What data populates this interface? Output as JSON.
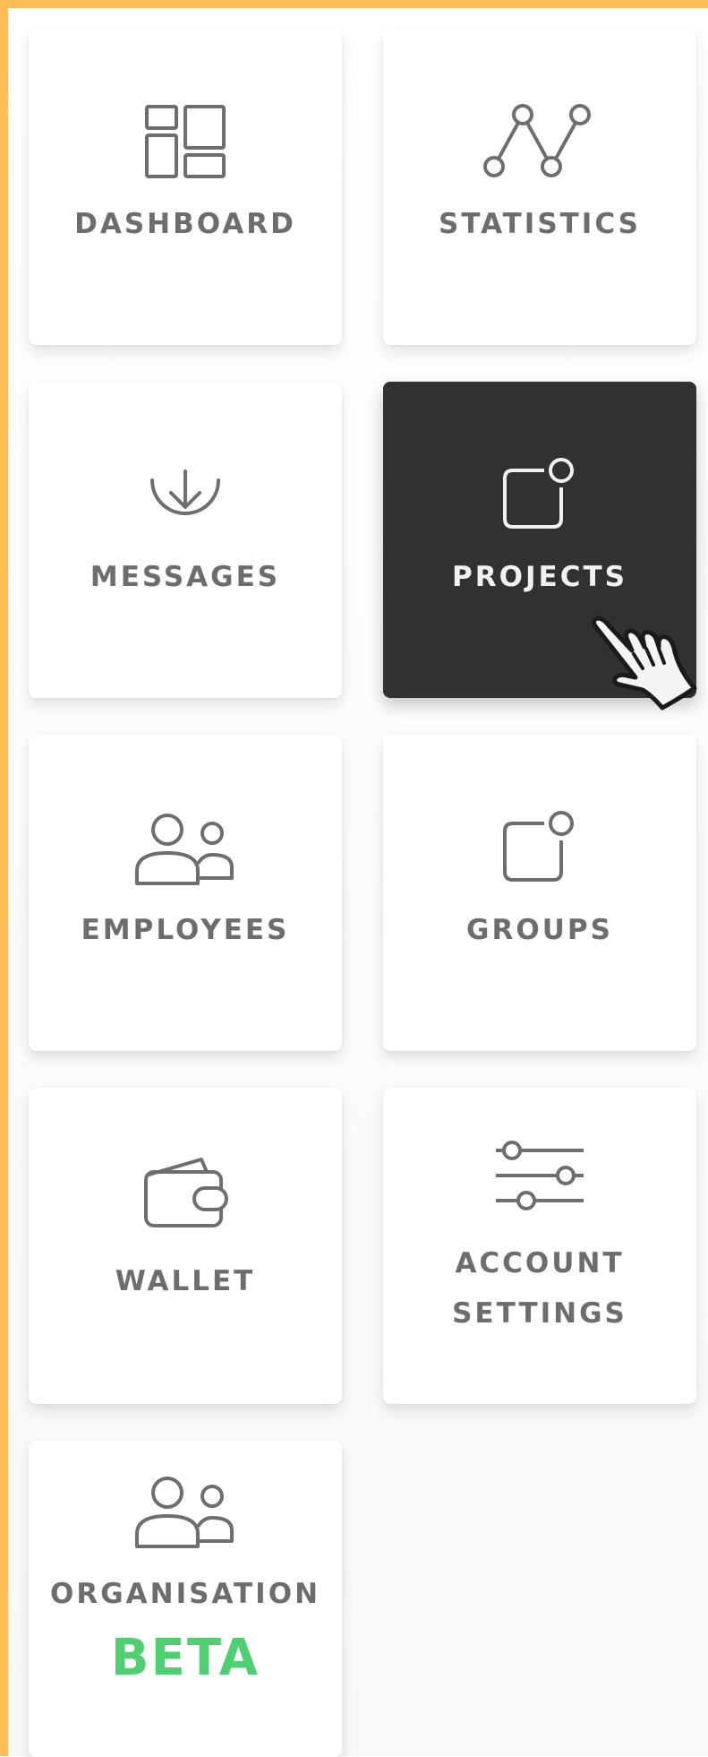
{
  "nav": {
    "tiles": [
      {
        "id": "dashboard",
        "label": "DASHBOARD",
        "icon": "dashboard-icon"
      },
      {
        "id": "statistics",
        "label": "STATISTICS",
        "icon": "line-chart-icon"
      },
      {
        "id": "messages",
        "label": "MESSAGES",
        "icon": "inbox-download-icon"
      },
      {
        "id": "projects",
        "label": "PROJECTS",
        "icon": "project-square-icon",
        "active": true
      },
      {
        "id": "employees",
        "label": "EMPLOYEES",
        "icon": "people-icon"
      },
      {
        "id": "groups",
        "label": "GROUPS",
        "icon": "group-square-icon"
      },
      {
        "id": "wallet",
        "label": "WALLET",
        "icon": "wallet-icon"
      },
      {
        "id": "account-settings",
        "label_line1": "ACCOUNT",
        "label_line2": "SETTINGS",
        "icon": "sliders-icon"
      },
      {
        "id": "organisation",
        "label": "ORGANISATION",
        "badge": "BETA",
        "icon": "organisation-people-icon"
      }
    ]
  },
  "cursor": {
    "icon": "hand-pointer-icon"
  },
  "colors": {
    "frame_accent": "#FDBE57",
    "active_tile_bg": "#313131",
    "label_text": "#6d6d6d",
    "active_label_text": "#f1f1f1",
    "beta_green": "#4fcf71"
  }
}
